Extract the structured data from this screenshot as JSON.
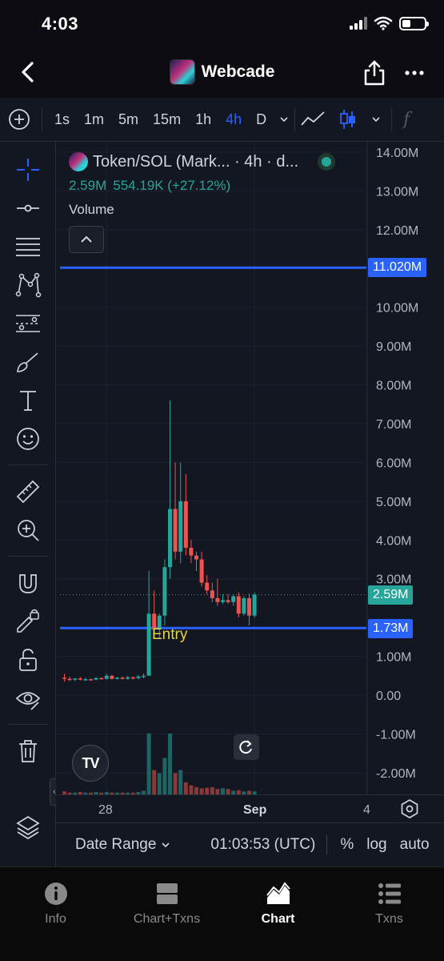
{
  "status": {
    "time": "4:03"
  },
  "nav": {
    "title": "Webcade"
  },
  "toolbar": {
    "intervals": [
      "1s",
      "1m",
      "5m",
      "15m",
      "1h",
      "4h",
      "D"
    ],
    "active_interval": "4h",
    "fx_label": "f"
  },
  "legend": {
    "symbol": "Token/SOL (Mark... · 4h · d...",
    "price": "2.59M",
    "change": "554.19K (+27.12%)",
    "volume_label": "Volume"
  },
  "price_axis": {
    "ticks": [
      "14.00M",
      "13.00M",
      "12.00M",
      "10.00M",
      "9.00M",
      "8.00M",
      "7.00M",
      "6.00M",
      "5.00M",
      "4.00M",
      "3.00M",
      "1.00M",
      "0.00",
      "-1.00M",
      "-2.00M"
    ],
    "tick_values": [
      14,
      13,
      12,
      10,
      9,
      8,
      7,
      6,
      5,
      4,
      3,
      1,
      0,
      -1,
      -2
    ],
    "labels": {
      "upper_line": "11.020M",
      "current": "2.59M",
      "entry": "1.73M"
    }
  },
  "lines": {
    "upper_value": 11.02,
    "entry_value": 1.73,
    "current_value": 2.59,
    "entry_text": "Entry"
  },
  "time_axis": {
    "labels": [
      "28",
      "Sep",
      "4"
    ]
  },
  "bottom_bar": {
    "date_range": "Date Range",
    "time": "01:03:53 (UTC)",
    "percent": "%",
    "log": "log",
    "auto": "auto"
  },
  "tabs": [
    {
      "label": "Info",
      "icon": "info-icon"
    },
    {
      "label": "Chart+Txns",
      "icon": "split-icon"
    },
    {
      "label": "Chart",
      "icon": "area-chart-icon"
    },
    {
      "label": "Txns",
      "icon": "list-icon"
    }
  ],
  "active_tab": "Chart",
  "colors": {
    "up": "#26a69a",
    "down": "#ef5350",
    "line": "#2962ff",
    "entry_text": "#e5d34a"
  },
  "chart_data": {
    "type": "candlestick",
    "y_unit": "M",
    "candles": [
      {
        "o": 0.45,
        "h": 0.55,
        "l": 0.35,
        "c": 0.42
      },
      {
        "o": 0.42,
        "h": 0.48,
        "l": 0.36,
        "c": 0.4
      },
      {
        "o": 0.4,
        "h": 0.44,
        "l": 0.36,
        "c": 0.43
      },
      {
        "o": 0.43,
        "h": 0.47,
        "l": 0.38,
        "c": 0.4
      },
      {
        "o": 0.4,
        "h": 0.45,
        "l": 0.37,
        "c": 0.41
      },
      {
        "o": 0.41,
        "h": 0.43,
        "l": 0.38,
        "c": 0.4
      },
      {
        "o": 0.4,
        "h": 0.46,
        "l": 0.38,
        "c": 0.44
      },
      {
        "o": 0.44,
        "h": 0.46,
        "l": 0.4,
        "c": 0.42
      },
      {
        "o": 0.42,
        "h": 0.55,
        "l": 0.4,
        "c": 0.5
      },
      {
        "o": 0.5,
        "h": 0.52,
        "l": 0.4,
        "c": 0.42
      },
      {
        "o": 0.42,
        "h": 0.47,
        "l": 0.4,
        "c": 0.45
      },
      {
        "o": 0.45,
        "h": 0.48,
        "l": 0.4,
        "c": 0.42
      },
      {
        "o": 0.42,
        "h": 0.5,
        "l": 0.4,
        "c": 0.46
      },
      {
        "o": 0.46,
        "h": 0.48,
        "l": 0.4,
        "c": 0.44
      },
      {
        "o": 0.44,
        "h": 0.52,
        "l": 0.4,
        "c": 0.48
      },
      {
        "o": 0.48,
        "h": 0.56,
        "l": 0.44,
        "c": 0.5
      },
      {
        "o": 0.5,
        "h": 3.2,
        "l": 1.4,
        "c": 2.1
      },
      {
        "o": 2.1,
        "h": 2.7,
        "l": 1.5,
        "c": 1.7
      },
      {
        "o": 1.7,
        "h": 2.1,
        "l": 1.45,
        "c": 2.05
      },
      {
        "o": 2.05,
        "h": 3.5,
        "l": 1.8,
        "c": 3.3
      },
      {
        "o": 3.3,
        "h": 7.6,
        "l": 3.0,
        "c": 4.8
      },
      {
        "o": 4.8,
        "h": 6.0,
        "l": 3.5,
        "c": 3.7
      },
      {
        "o": 3.7,
        "h": 6.0,
        "l": 3.4,
        "c": 5.0
      },
      {
        "o": 5.0,
        "h": 5.7,
        "l": 3.6,
        "c": 3.8
      },
      {
        "o": 3.8,
        "h": 4.0,
        "l": 3.4,
        "c": 3.6
      },
      {
        "o": 3.6,
        "h": 3.7,
        "l": 3.2,
        "c": 3.5
      },
      {
        "o": 3.5,
        "h": 3.7,
        "l": 2.8,
        "c": 2.9
      },
      {
        "o": 2.9,
        "h": 3.1,
        "l": 2.6,
        "c": 2.7
      },
      {
        "o": 2.7,
        "h": 2.9,
        "l": 2.4,
        "c": 2.5
      },
      {
        "o": 2.5,
        "h": 3.0,
        "l": 2.3,
        "c": 2.4
      },
      {
        "o": 2.4,
        "h": 2.6,
        "l": 2.35,
        "c": 2.45
      },
      {
        "o": 2.45,
        "h": 2.6,
        "l": 2.35,
        "c": 2.4
      },
      {
        "o": 2.4,
        "h": 2.6,
        "l": 2.3,
        "c": 2.55
      },
      {
        "o": 2.55,
        "h": 2.65,
        "l": 2.0,
        "c": 2.1
      },
      {
        "o": 2.1,
        "h": 2.55,
        "l": 2.05,
        "c": 2.5
      },
      {
        "o": 2.5,
        "h": 2.62,
        "l": 1.8,
        "c": 2.05
      },
      {
        "o": 2.05,
        "h": 2.65,
        "l": 2.0,
        "c": 2.59
      }
    ],
    "volumes": [
      0.5,
      0.3,
      0.3,
      0.4,
      0.3,
      0.3,
      0.4,
      0.3,
      0.4,
      0.3,
      0.3,
      0.3,
      0.3,
      0.3,
      0.4,
      0.6,
      10.0,
      4.0,
      3.5,
      6.0,
      10.0,
      3.5,
      4.0,
      2.0,
      1.5,
      1.2,
      1.0,
      1.1,
      1.2,
      0.9,
      1.0,
      0.9,
      0.6,
      0.7,
      0.5,
      0.6,
      0.5
    ]
  }
}
